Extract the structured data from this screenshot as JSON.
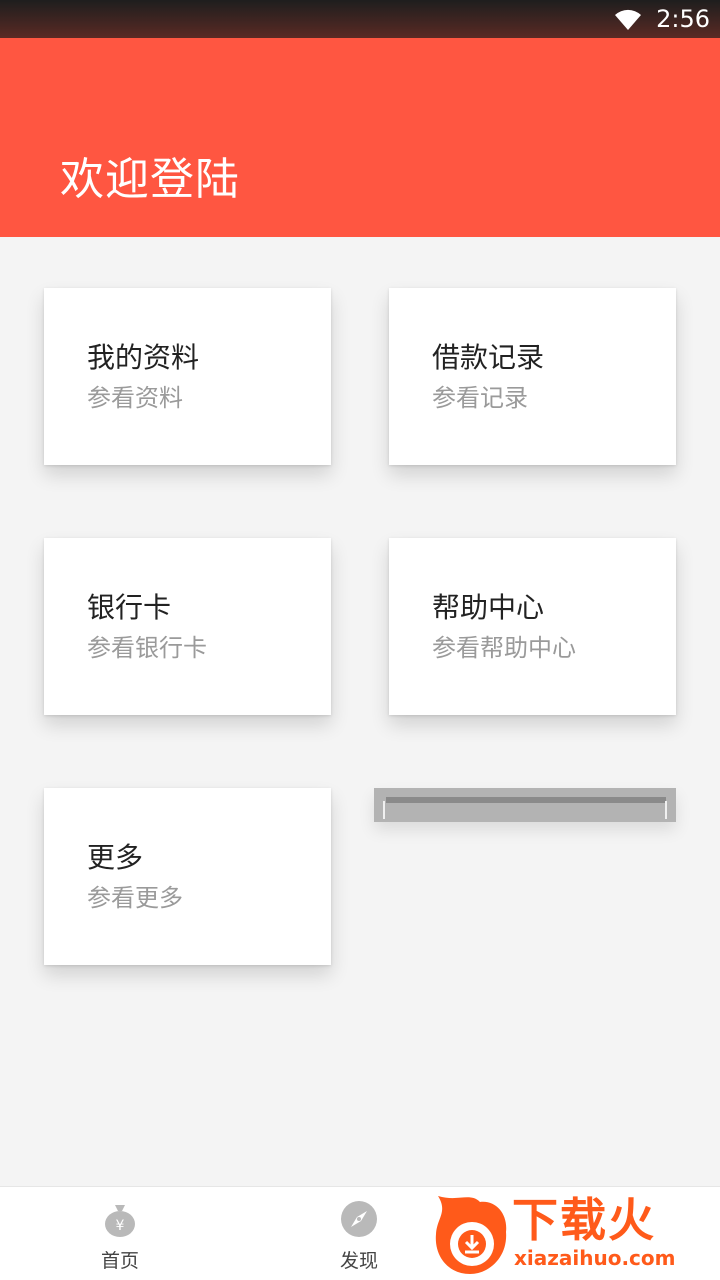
{
  "status_bar": {
    "time": "2:56",
    "wifi_icon": "wifi-icon"
  },
  "header": {
    "title": "欢迎登陆",
    "background_color": "#ff5641"
  },
  "cards": [
    {
      "title": "我的资料",
      "subtitle": "参看资料"
    },
    {
      "title": "借款记录",
      "subtitle": "参看记录"
    },
    {
      "title": "银行卡",
      "subtitle": "参看银行卡"
    },
    {
      "title": "帮助中心",
      "subtitle": "参看帮助中心"
    },
    {
      "title": "更多",
      "subtitle": "参看更多"
    }
  ],
  "bottom_nav": {
    "items": [
      {
        "label": "首页",
        "icon": "money-bag-icon"
      },
      {
        "label": "发现",
        "icon": "compass-icon"
      }
    ]
  },
  "watermark": {
    "brand": "下载火",
    "url": "xiazaihuo.com",
    "color": "#ff5a1a"
  }
}
